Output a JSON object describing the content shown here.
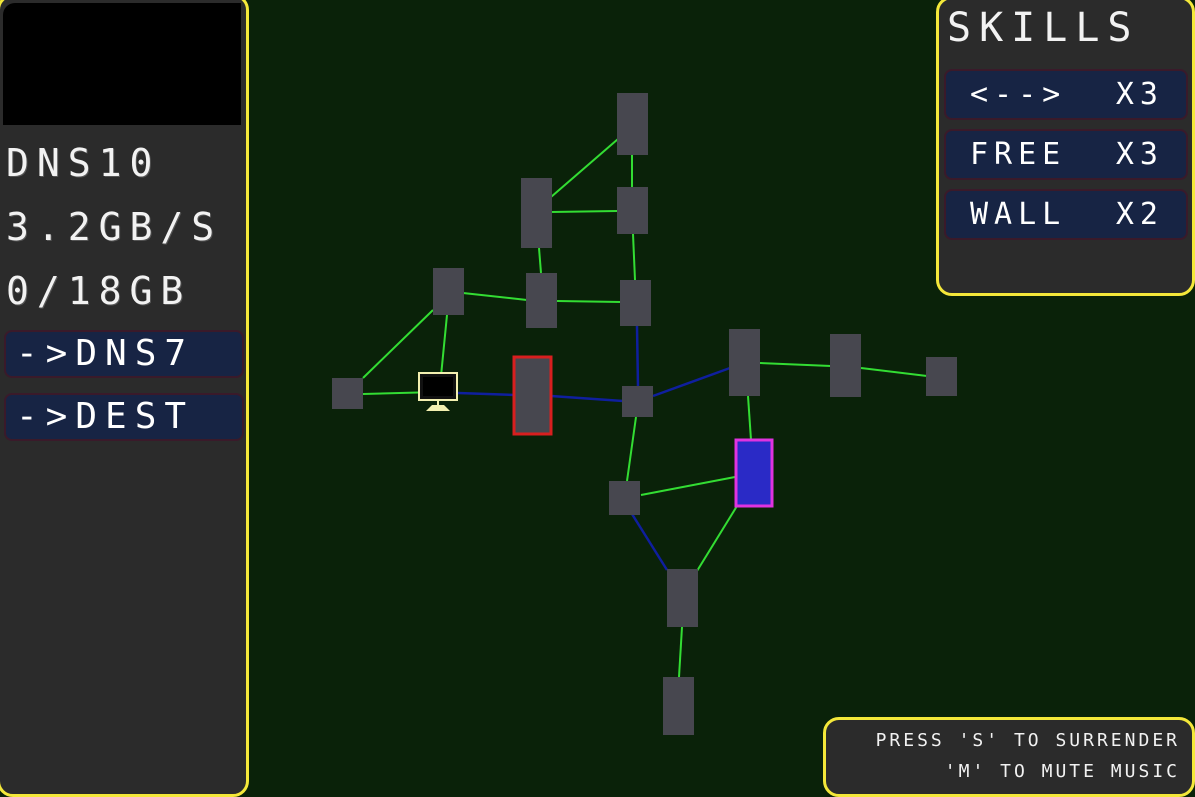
{
  "stats": {
    "node_name": "DNS10",
    "bandwidth": "3.2GB/S",
    "storage": "0/18GB"
  },
  "routes": [
    {
      "label": "->DNS7"
    },
    {
      "label": "->DEST"
    }
  ],
  "skills": {
    "title": "SKILLS",
    "items": [
      {
        "name": "<-->",
        "count": "X3"
      },
      {
        "name": "FREE",
        "count": "X3"
      },
      {
        "name": "WALL",
        "count": "X2"
      }
    ]
  },
  "help": {
    "line1": "PRESS 'S' TO SURRENDER",
    "line2": "'M' TO MUTE MUSIC"
  },
  "colors": {
    "background": "#0a2209",
    "node": "#47474f",
    "link_green": "#33dd33",
    "link_blue": "#0f1f9e",
    "selected_border": "#d81f1f",
    "target_border": "#e033e0",
    "target_fill": "#2a2ac6",
    "panel_border": "#f4e83a"
  },
  "icons": {
    "player": "computer-monitor-icon"
  }
}
